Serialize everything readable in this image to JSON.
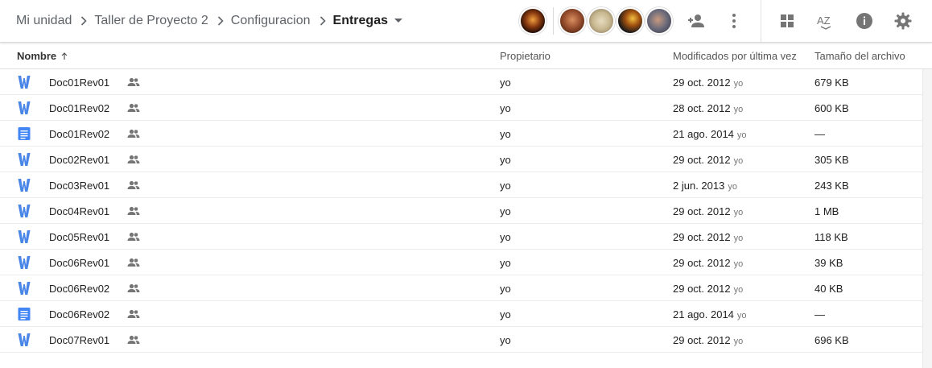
{
  "breadcrumb": {
    "items": [
      {
        "label": "Mi unidad"
      },
      {
        "label": "Taller de Proyecto 2"
      },
      {
        "label": "Configuracion"
      },
      {
        "label": "Entregas"
      }
    ]
  },
  "toolbar": {
    "icons": [
      "add-person-icon",
      "more-vert-icon",
      "grid-view-icon",
      "sort-az-icon",
      "info-icon",
      "settings-icon"
    ],
    "sort_label": "AZ"
  },
  "columns": {
    "name": "Nombre",
    "owner": "Propietario",
    "modified": "Modificados por última vez",
    "size": "Tamaño del archivo"
  },
  "files": [
    {
      "type": "word",
      "name": "Doc01Rev01",
      "owner": "yo",
      "modified": "29 oct. 2012",
      "modified_by": "yo",
      "size": "679 KB"
    },
    {
      "type": "word",
      "name": "Doc01Rev02",
      "owner": "yo",
      "modified": "28 oct. 2012",
      "modified_by": "yo",
      "size": "600 KB"
    },
    {
      "type": "gdoc",
      "name": "Doc01Rev02",
      "owner": "yo",
      "modified": "21 ago. 2014",
      "modified_by": "yo",
      "size": "—"
    },
    {
      "type": "word",
      "name": "Doc02Rev01",
      "owner": "yo",
      "modified": "29 oct. 2012",
      "modified_by": "yo",
      "size": "305 KB"
    },
    {
      "type": "word",
      "name": "Doc03Rev01",
      "owner": "yo",
      "modified": "2 jun. 2013",
      "modified_by": "yo",
      "size": "243 KB"
    },
    {
      "type": "word",
      "name": "Doc04Rev01",
      "owner": "yo",
      "modified": "29 oct. 2012",
      "modified_by": "yo",
      "size": "1 MB"
    },
    {
      "type": "word",
      "name": "Doc05Rev01",
      "owner": "yo",
      "modified": "29 oct. 2012",
      "modified_by": "yo",
      "size": "118 KB"
    },
    {
      "type": "word",
      "name": "Doc06Rev01",
      "owner": "yo",
      "modified": "29 oct. 2012",
      "modified_by": "yo",
      "size": "39 KB"
    },
    {
      "type": "word",
      "name": "Doc06Rev02",
      "owner": "yo",
      "modified": "29 oct. 2012",
      "modified_by": "yo",
      "size": "40 KB"
    },
    {
      "type": "gdoc",
      "name": "Doc06Rev02",
      "owner": "yo",
      "modified": "21 ago. 2014",
      "modified_by": "yo",
      "size": "—"
    },
    {
      "type": "word",
      "name": "Doc07Rev01",
      "owner": "yo",
      "modified": "29 oct. 2012",
      "modified_by": "yo",
      "size": "696 KB"
    }
  ],
  "colors": {
    "word_blue": "#4a86e8",
    "gdoc_blue": "#4285f4",
    "icon_gray": "#757575"
  }
}
